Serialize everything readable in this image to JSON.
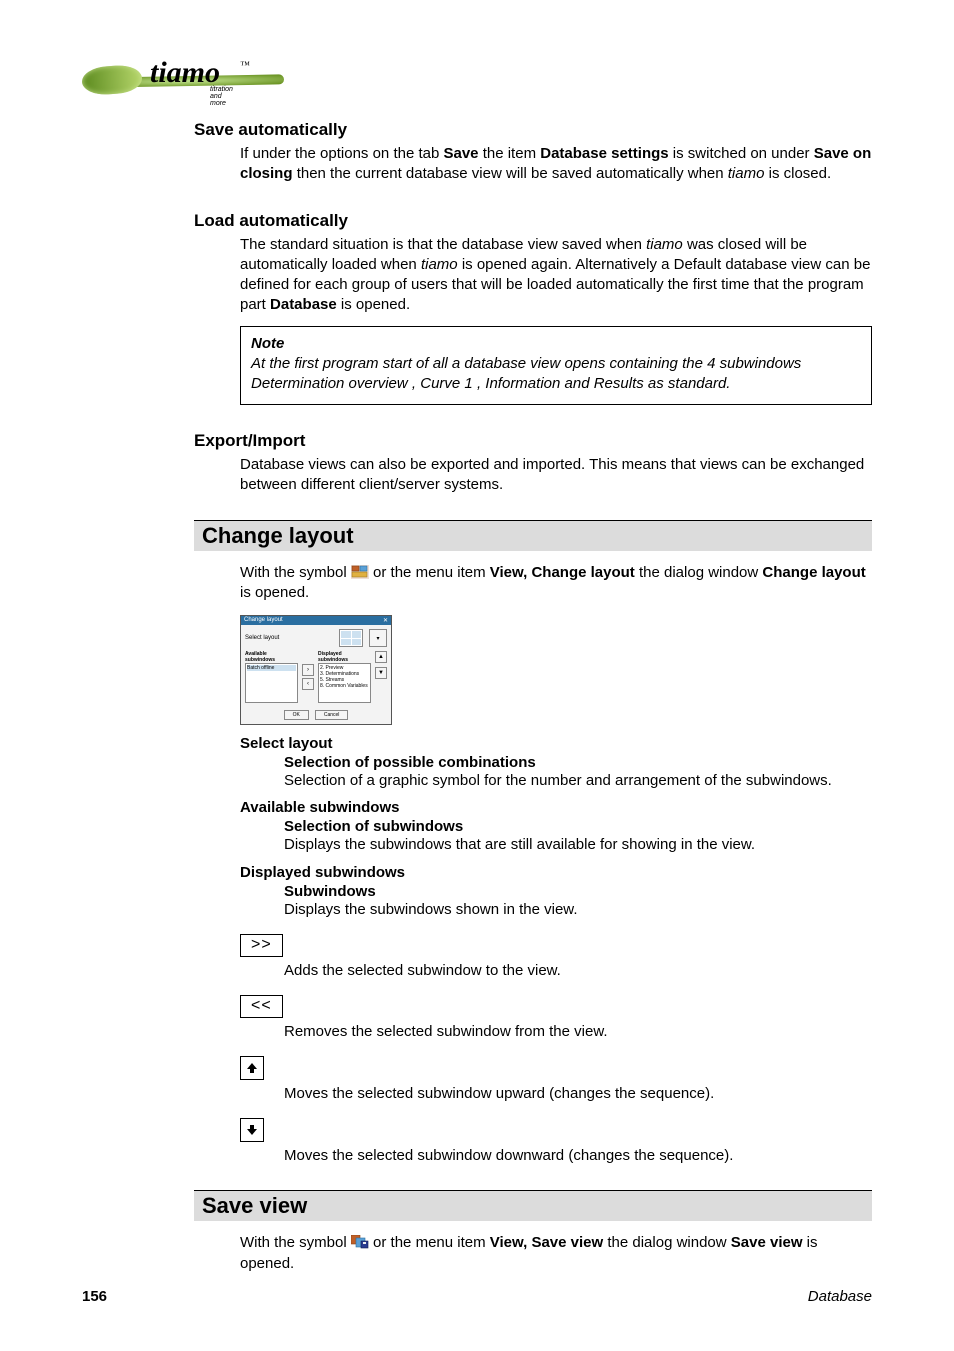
{
  "logo": {
    "brand": "tiamo",
    "tm": "™",
    "tagline": "titration and more"
  },
  "save_auto": {
    "title": "Save automatically",
    "t1": "If under the options on the tab ",
    "b1": "Save",
    "t2": " the item ",
    "b2": "Database settings",
    "t3": " is switched on under ",
    "b3": "Save on closing",
    "t4": " then the current database view will be saved automatically when ",
    "i1": "tiamo",
    "t5": " is closed."
  },
  "load_auto": {
    "title": "Load automatically",
    "t1": "The standard situation is that the database view saved when ",
    "i1": "tiamo",
    "t2": " was closed will be automatically loaded when ",
    "i2": "tiamo",
    "t3": " is opened again. Alternatively a Default database view can be defined for each group of users that will be loaded automatically the first time that the program part ",
    "b1": "Database",
    "t4": " is opened."
  },
  "note": {
    "label": "Note",
    "t1": "At the first program start of all a database view opens containing the 4 subwindows ",
    "b1": "Determination overview",
    "s1": ", ",
    "b2": "Curve 1",
    "s2": ", ",
    "b3": "Information",
    "t2": " and ",
    "b4": "Results",
    "t3": " as standard."
  },
  "export_import": {
    "title": "Export/Import",
    "body": "Database views can also be exported and imported. This means that views can be exchanged between different client/server systems."
  },
  "change_layout": {
    "title": "Change layout",
    "intro_t1": "With the symbol ",
    "intro_t2": " or the menu item ",
    "intro_b1": "View, Change layout",
    "intro_t3": " the dialog window ",
    "intro_b2": "Change layout",
    "intro_t4": " is opened.",
    "select_layout": "Select layout",
    "comb_title": "Selection of possible combinations",
    "comb_body": "Selection of a graphic symbol for the number and arrangement of the subwindows.",
    "avail_title": "Available subwindows",
    "avail_sub": "Selection of subwindows",
    "avail_body": "Displays the subwindows that are still available for showing in the view.",
    "disp_title": "Displayed subwindows",
    "disp_sub": "Subwindows",
    "disp_body": "Displays the subwindows shown in the view.",
    "add_btn": ">>",
    "add_body": "Adds the selected subwindow to the view.",
    "rem_btn": "<<",
    "rem_body": "Removes the selected subwindow from the view.",
    "up_body": "Moves the selected subwindow upward (changes the sequence).",
    "down_body": "Moves the selected subwindow downward (changes the sequence)."
  },
  "dialog_thumb": {
    "title": "Change layout",
    "close": "✕",
    "select_label": "Select layout",
    "avail_header": "Available subwindows",
    "disp_header": "Displayed subwindows",
    "avail_items": "Batch offline",
    "disp_items": [
      "2. Preview",
      "3. Determinations",
      "5. Streams",
      "8. Common Variables"
    ],
    "ok": "OK",
    "cancel": "Cancel"
  },
  "save_view": {
    "title": "Save view",
    "t1": "With the symbol ",
    "t2": " or the menu item ",
    "b1": "View, Save view",
    "t3": " the dialog window ",
    "b2": "Save view",
    "t4": " is opened."
  },
  "footer": {
    "pageno": "156",
    "section": "Database"
  }
}
